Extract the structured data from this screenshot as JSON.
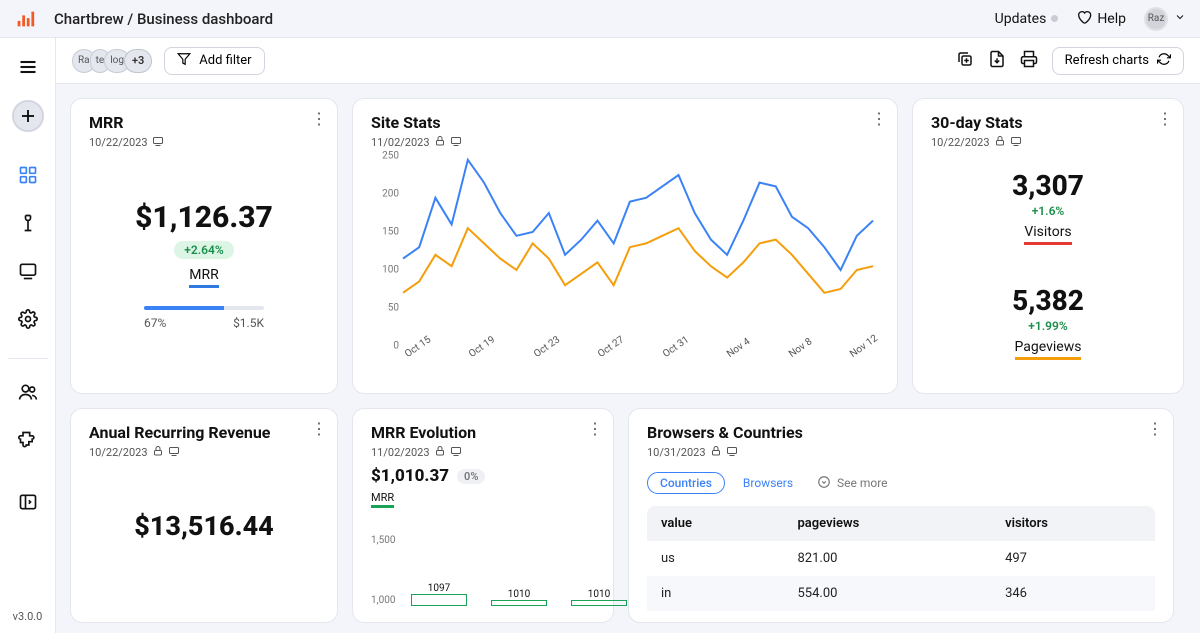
{
  "breadcrumb": "Chartbrew / Business dashboard",
  "topbar": {
    "updates": "Updates",
    "help": "Help",
    "user_initials": "Raz"
  },
  "toolbar": {
    "chips": [
      "Ra",
      "te",
      "log"
    ],
    "chip_more": "+3",
    "add_filter": "Add filter",
    "refresh": "Refresh charts"
  },
  "sidebar": {
    "version": "v3.0.0"
  },
  "cards": {
    "mrr": {
      "title": "MRR",
      "date": "10/22/2023",
      "value": "$1,126.37",
      "change": "+2.64%",
      "label": "MRR",
      "progress_pct": "67%",
      "progress_max": "$1.5K"
    },
    "sitestats": {
      "title": "Site Stats",
      "date": "11/02/2023"
    },
    "stats30": {
      "title": "30-day Stats",
      "date": "10/22/2023",
      "visitors_value": "3,307",
      "visitors_change": "+1.6%",
      "visitors_label": "Visitors",
      "pageviews_value": "5,382",
      "pageviews_change": "+1.99%",
      "pageviews_label": "Pageviews"
    },
    "arr": {
      "title": "Anual Recurring Revenue",
      "date": "10/22/2023",
      "value": "$13,516.44"
    },
    "mrrevo": {
      "title": "MRR Evolution",
      "date": "11/02/2023",
      "value": "$1,010.37",
      "change": "0%",
      "label": "MRR"
    },
    "browsers": {
      "title": "Browsers & Countries",
      "date": "10/31/2023",
      "tabs": {
        "countries": "Countries",
        "browsers": "Browsers",
        "seemore": "See more"
      },
      "headers": {
        "value": "value",
        "pageviews": "pageviews",
        "visitors": "visitors"
      },
      "rows": [
        {
          "value": "us",
          "pageviews": "821.00",
          "visitors": "497"
        },
        {
          "value": "in",
          "pageviews": "554.00",
          "visitors": "346"
        }
      ]
    }
  },
  "chart_data": [
    {
      "id": "site_stats",
      "type": "line",
      "x": [
        "Oct 15",
        "Oct 19",
        "Oct 23",
        "Oct 27",
        "Oct 31",
        "Nov 4",
        "Nov 8",
        "Nov 12"
      ],
      "ylim": [
        0,
        250
      ],
      "y_ticks": [
        0,
        50,
        100,
        150,
        200,
        250
      ],
      "series": [
        {
          "name": "blue",
          "color": "#3b82f6",
          "values": [
            115,
            130,
            195,
            160,
            245,
            215,
            175,
            145,
            150,
            175,
            120,
            140,
            165,
            135,
            190,
            195,
            210,
            225,
            175,
            140,
            120,
            165,
            215,
            210,
            170,
            155,
            130,
            100,
            145,
            165
          ]
        },
        {
          "name": "orange",
          "color": "#f59e0b",
          "values": [
            70,
            85,
            120,
            105,
            155,
            135,
            115,
            100,
            135,
            115,
            80,
            95,
            110,
            80,
            130,
            135,
            145,
            155,
            125,
            105,
            90,
            110,
            135,
            140,
            120,
            95,
            70,
            75,
            100,
            105
          ]
        }
      ]
    },
    {
      "id": "mrr_evolution",
      "type": "bar",
      "y_ticks": [
        1000,
        1500
      ],
      "categories": [
        "",
        "",
        ""
      ],
      "values": [
        1097,
        1010,
        1010
      ]
    }
  ]
}
